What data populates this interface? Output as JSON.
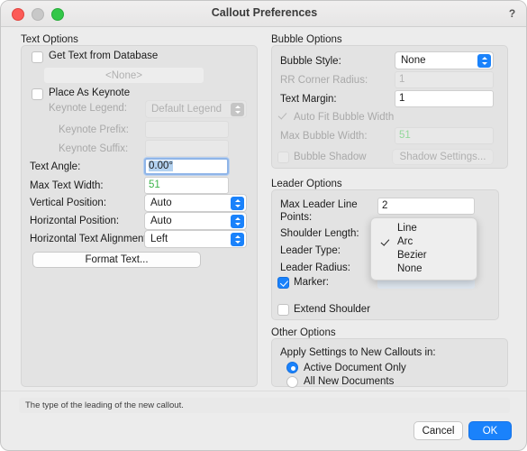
{
  "window": {
    "title": "Callout Preferences",
    "help_label": "?",
    "traffic_lights": [
      "close-red",
      "minimize-yellow",
      "zoom-green"
    ]
  },
  "text_options": {
    "group_label": "Text Options",
    "get_text_from_database": {
      "label": "Get Text from Database",
      "checked": false
    },
    "database_field": {
      "value": "<None>",
      "enabled": false
    },
    "place_as_keynote": {
      "label": "Place As Keynote",
      "checked": false
    },
    "keynote_legend": {
      "label": "Keynote Legend:",
      "value": "Default Legend",
      "enabled": false
    },
    "keynote_prefix": {
      "label": "Keynote Prefix:",
      "value": "",
      "enabled": false
    },
    "keynote_suffix": {
      "label": "Keynote Suffix:",
      "value": "",
      "enabled": false
    },
    "text_angle": {
      "label": "Text Angle:",
      "value": "0.00°",
      "focused": true,
      "selected": true
    },
    "max_text_width": {
      "label": "Max Text Width:",
      "value": "51"
    },
    "vertical_position": {
      "label": "Vertical Position:",
      "value": "Auto"
    },
    "horizontal_position": {
      "label": "Horizontal Position:",
      "value": "Auto"
    },
    "horizontal_text_alignment": {
      "label": "Horizontal Text Alignment:",
      "value": "Left"
    },
    "format_text_button": "Format Text..."
  },
  "bubble_options": {
    "group_label": "Bubble Options",
    "bubble_style": {
      "label": "Bubble Style:",
      "value": "None"
    },
    "rr_corner_radius": {
      "label": "RR Corner Radius:",
      "value": "1",
      "enabled": false
    },
    "text_margin": {
      "label": "Text Margin:",
      "value": "1"
    },
    "auto_fit_bubble_width": {
      "label": "Auto Fit Bubble Width",
      "checked": true,
      "enabled": false
    },
    "max_bubble_width": {
      "label": "Max Bubble Width:",
      "value": "51",
      "enabled": false
    },
    "bubble_shadow": {
      "label": "Bubble Shadow",
      "checked": false,
      "enabled": false
    },
    "shadow_settings_button": {
      "label": "Shadow Settings...",
      "enabled": false
    }
  },
  "leader_options": {
    "group_label": "Leader Options",
    "max_leader_line_points": {
      "label_line1": "Max Leader Line",
      "label_line2": "Points:",
      "value": "2"
    },
    "shoulder_length": {
      "label": "Shoulder Length:"
    },
    "leader_type": {
      "label": "Leader Type:",
      "value": "Arc"
    },
    "leader_radius": {
      "label": "Leader Radius:"
    },
    "marker": {
      "label": "Marker:",
      "checked": true
    },
    "extend_shoulder": {
      "label": "Extend Shoulder",
      "checked": false
    }
  },
  "leader_type_menu": {
    "open": true,
    "items": [
      {
        "label": "Line",
        "checked": false
      },
      {
        "label": "Arc",
        "checked": true
      },
      {
        "label": "Bezier",
        "checked": false
      },
      {
        "label": "None",
        "checked": false
      }
    ]
  },
  "other_options": {
    "group_label": "Other Options",
    "apply_label": "Apply Settings to New Callouts in:",
    "radios": [
      {
        "label": "Active Document Only",
        "selected": true
      },
      {
        "label": "All New Documents",
        "selected": false
      }
    ]
  },
  "footer": {
    "status_text": "The type of the leading of the new callout.",
    "cancel_label": "Cancel",
    "ok_label": "OK"
  },
  "colors": {
    "accent_blue": "#1a82fb",
    "window_bg": "#ececec",
    "group_bg": "#e3e3e3",
    "green_value": "#3cb44a",
    "selection_blue": "#b4d2f0"
  }
}
